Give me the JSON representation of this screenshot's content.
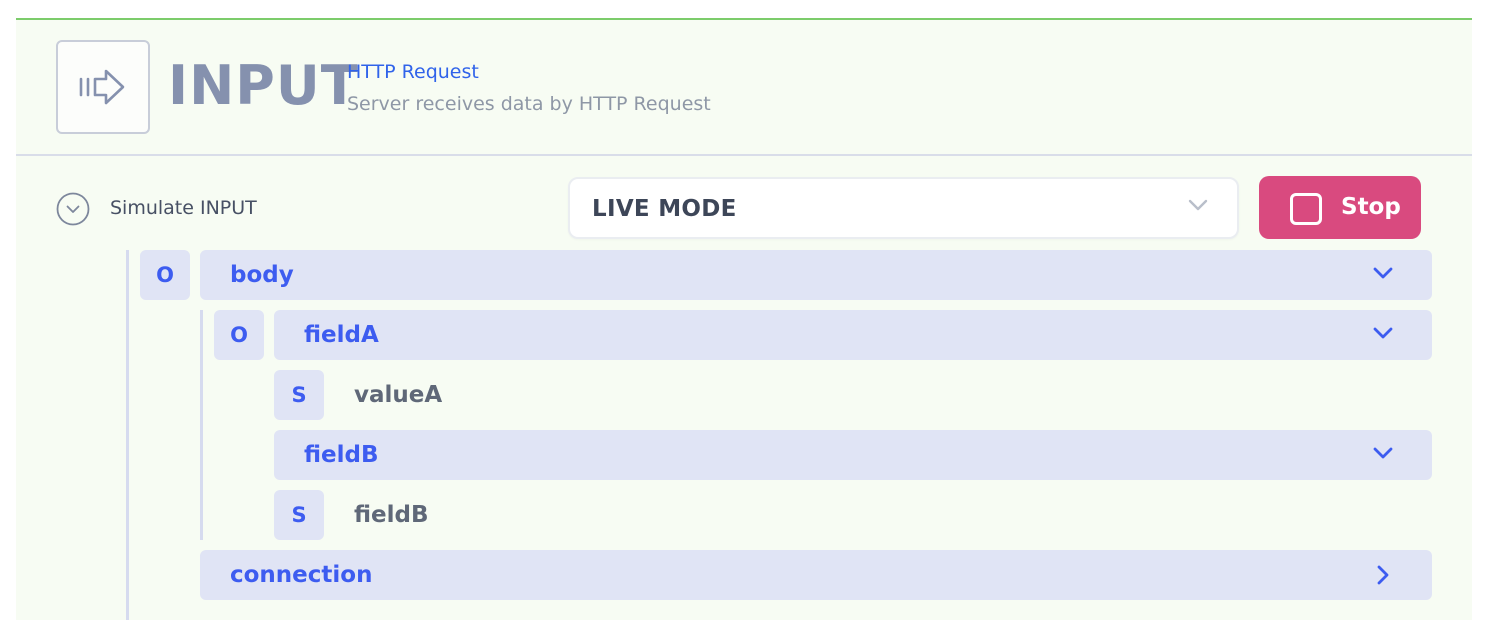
{
  "header": {
    "title": "INPUT",
    "subtitle": "HTTP Request",
    "description": "Server receives data by HTTP Request",
    "icon": "input-arrow-icon"
  },
  "simulate": {
    "label": "Simulate INPUT",
    "mode_select": {
      "value": "LIVE MODE"
    },
    "stop_label": "Stop"
  },
  "tree": {
    "root_badge": "O",
    "body": {
      "label": "body"
    },
    "fieldA": {
      "badge": "O",
      "label": "fieldA"
    },
    "valueA": {
      "badge": "S",
      "value": "valueA"
    },
    "fieldB": {
      "label": "fieldB"
    },
    "fieldB_value": {
      "badge": "S",
      "value": "fieldB"
    },
    "connection": {
      "label": "connection"
    }
  },
  "colors": {
    "accent": "#3d5cf0",
    "stop_button": "#d94a7f",
    "panel_bg": "#f7fcf3",
    "top_border": "#7ccc6b",
    "row_bg": "#e0e4f5"
  }
}
